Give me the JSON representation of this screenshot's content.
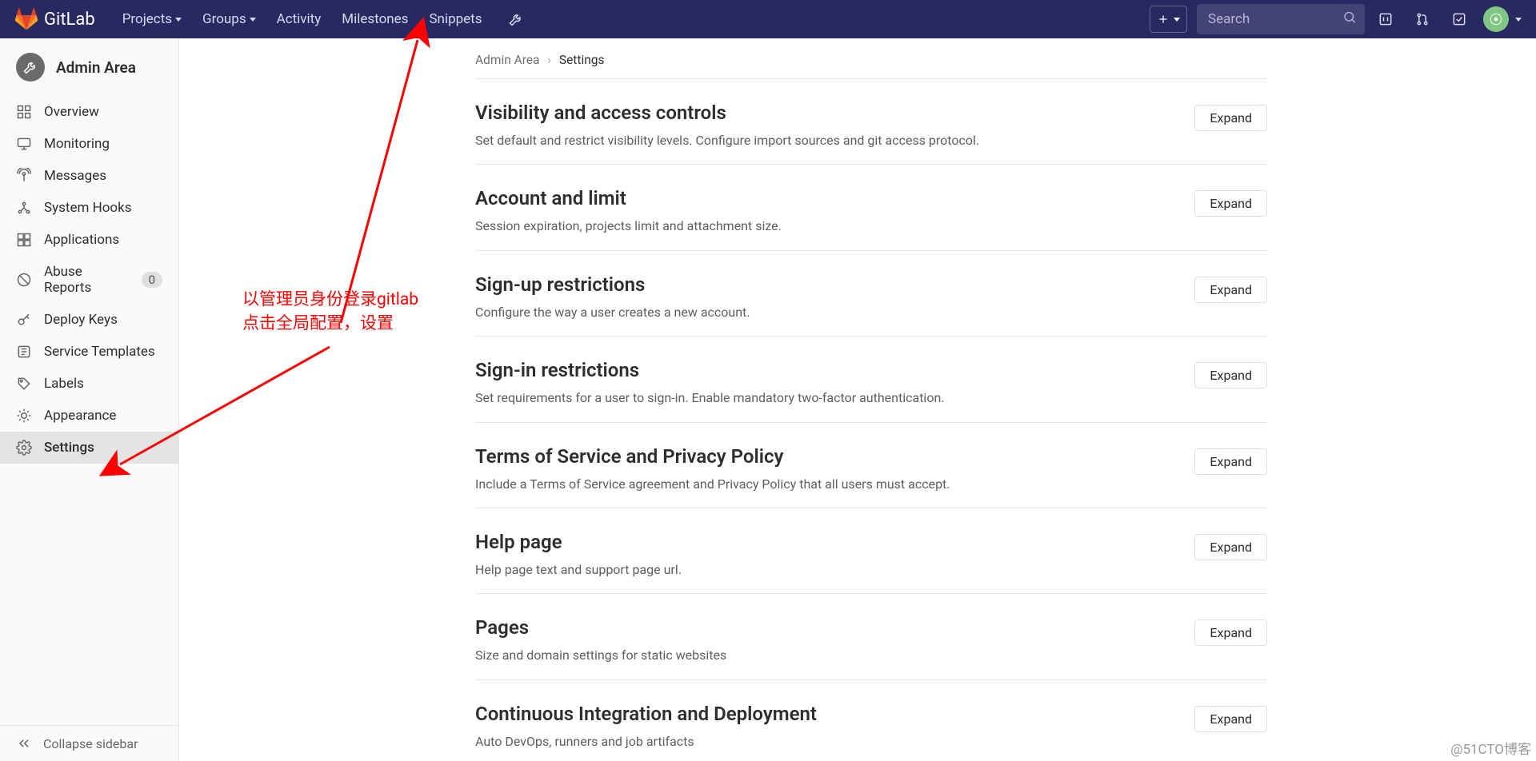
{
  "brand": "GitLab",
  "nav": {
    "projects": "Projects",
    "groups": "Groups",
    "activity": "Activity",
    "milestones": "Milestones",
    "snippets": "Snippets"
  },
  "search_placeholder": "Search",
  "sidebar": {
    "title": "Admin Area",
    "items": [
      {
        "icon": "overview",
        "label": "Overview"
      },
      {
        "icon": "monitoring",
        "label": "Monitoring"
      },
      {
        "icon": "messages",
        "label": "Messages"
      },
      {
        "icon": "hooks",
        "label": "System Hooks"
      },
      {
        "icon": "apps",
        "label": "Applications"
      },
      {
        "icon": "abuse",
        "label": "Abuse Reports",
        "badge": "0"
      },
      {
        "icon": "key",
        "label": "Deploy Keys"
      },
      {
        "icon": "service",
        "label": "Service Templates"
      },
      {
        "icon": "labels",
        "label": "Labels"
      },
      {
        "icon": "appearance",
        "label": "Appearance"
      },
      {
        "icon": "settings",
        "label": "Settings",
        "active": true
      }
    ],
    "collapse": "Collapse sidebar"
  },
  "breadcrumb": {
    "root": "Admin Area",
    "current": "Settings"
  },
  "expand_label": "Expand",
  "sections": [
    {
      "title": "Visibility and access controls",
      "desc": "Set default and restrict visibility levels. Configure import sources and git access protocol."
    },
    {
      "title": "Account and limit",
      "desc": "Session expiration, projects limit and attachment size."
    },
    {
      "title": "Sign-up restrictions",
      "desc": "Configure the way a user creates a new account."
    },
    {
      "title": "Sign-in restrictions",
      "desc": "Set requirements for a user to sign-in. Enable mandatory two-factor authentication."
    },
    {
      "title": "Terms of Service and Privacy Policy",
      "desc": "Include a Terms of Service agreement and Privacy Policy that all users must accept."
    },
    {
      "title": "Help page",
      "desc": "Help page text and support page url."
    },
    {
      "title": "Pages",
      "desc": "Size and domain settings for static websites"
    },
    {
      "title": "Continuous Integration and Deployment",
      "desc": "Auto DevOps, runners and job artifacts"
    }
  ],
  "annotation": {
    "line1": "以管理员身份登录gitlab",
    "line2": "点击全局配置，设置"
  },
  "watermark": "@51CTO博客"
}
